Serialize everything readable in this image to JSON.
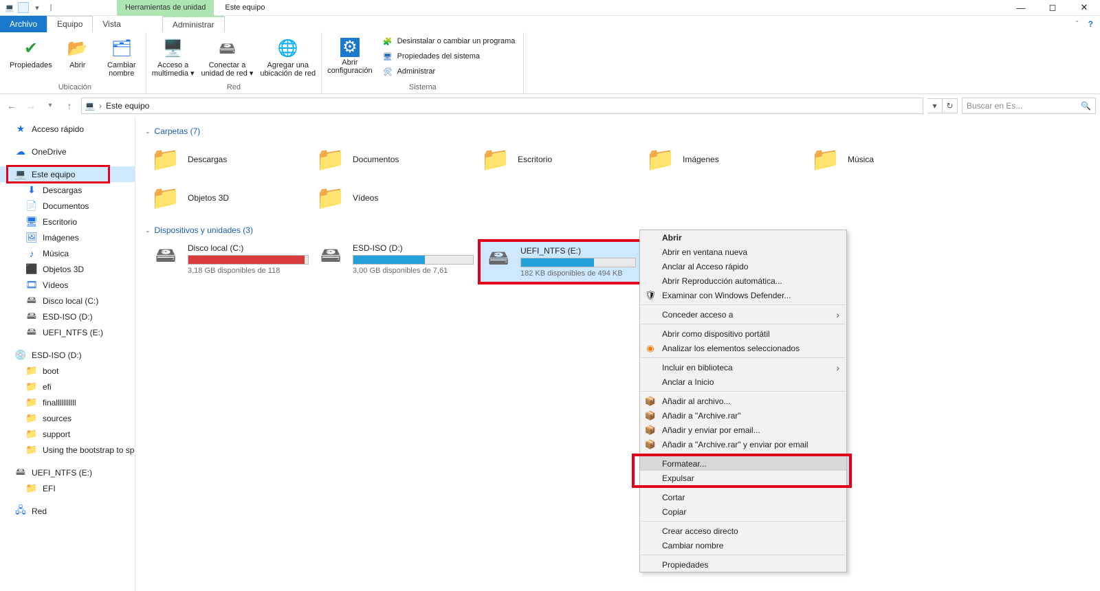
{
  "titlebar": {
    "context_tab": "Herramientas de unidad",
    "window_title": "Este equipo"
  },
  "tabs": {
    "file": "Archivo",
    "equipo": "Equipo",
    "vista": "Vista",
    "administrar": "Administrar"
  },
  "ribbon": {
    "ubicacion": {
      "name": "Ubicación",
      "propiedades": "Propiedades",
      "abrir": "Abrir",
      "cambiar_nombre": "Cambiar\nnombre"
    },
    "red": {
      "name": "Red",
      "acceso": "Acceso a\nmultimedia ▾",
      "conectar": "Conectar a\nunidad de red ▾",
      "agregar": "Agregar una\nubicación de red"
    },
    "sistema": {
      "name": "Sistema",
      "abrir_cfg": "Abrir\nconfiguración",
      "desinstalar": "Desinstalar o cambiar un programa",
      "propiedades_sistema": "Propiedades del sistema",
      "administrar": "Administrar"
    }
  },
  "nav": {
    "location": "Este equipo",
    "search_placeholder": "Buscar en Es..."
  },
  "sidebar": {
    "acceso_rapido": "Acceso rápido",
    "onedrive": "OneDrive",
    "este_equipo": "Este equipo",
    "descargas": "Descargas",
    "documentos": "Documentos",
    "escritorio": "Escritorio",
    "imagenes": "Imágenes",
    "musica": "Música",
    "objetos3d": "Objetos 3D",
    "videos": "Vídeos",
    "disco_c": "Disco local (C:)",
    "esd_iso": "ESD-ISO (D:)",
    "uefi": "UEFI_NTFS (E:)",
    "esd_iso_root": "ESD-ISO (D:)",
    "boot": "boot",
    "efi": "efi",
    "final": "finalllllllllll",
    "sources": "sources",
    "support": "support",
    "bootstrap": "Using the bootstrap to speed",
    "uefi_root": "UEFI_NTFS (E:)",
    "efi2": "EFI",
    "red": "Red"
  },
  "sections": {
    "carpetas": "Carpetas (7)",
    "dispositivos": "Dispositivos y unidades (3)"
  },
  "folders": [
    {
      "label": "Descargas",
      "icon": "download"
    },
    {
      "label": "Documentos",
      "icon": "document"
    },
    {
      "label": "Escritorio",
      "icon": "desktop"
    },
    {
      "label": "Imágenes",
      "icon": "images"
    },
    {
      "label": "Música",
      "icon": "music"
    },
    {
      "label": "Objetos 3D",
      "icon": "3d"
    },
    {
      "label": "Vídeos",
      "icon": "video"
    }
  ],
  "drives": {
    "c": {
      "name": "Disco local (C:)",
      "free": "3,18 GB disponibles de 118",
      "pct": 97,
      "color": "#d83b3b"
    },
    "d": {
      "name": "ESD-ISO (D:)",
      "free": "3,00 GB disponibles de 7,61",
      "pct": 60,
      "color": "#26a0da"
    },
    "e": {
      "name": "UEFI_NTFS (E:)",
      "free": "182 KB disponibles de 494 KB",
      "pct": 64,
      "color": "#26a0da"
    }
  },
  "context_menu": {
    "abrir": "Abrir",
    "ventana_nueva": "Abrir en ventana nueva",
    "anclar_acceso": "Anclar al Acceso rápido",
    "reproduccion": "Abrir Reproducción automática...",
    "defender": "Examinar con Windows Defender...",
    "conceder": "Conceder acceso a",
    "portatil": "Abrir como dispositivo portátil",
    "analizar": "Analizar los elementos seleccionados",
    "biblioteca": "Incluir en biblioteca",
    "anclar_inicio": "Anclar a Inicio",
    "anadir_archivo": "Añadir al archivo...",
    "anadir_archive": "Añadir a \"Archive.rar\"",
    "anadir_email": "Añadir y enviar por email...",
    "anadir_archive_email": "Añadir a \"Archive.rar\" y enviar por email",
    "formatear": "Formatear...",
    "expulsar": "Expulsar",
    "cortar": "Cortar",
    "copiar": "Copiar",
    "crear_acceso": "Crear acceso directo",
    "cambiar_nombre": "Cambiar nombre",
    "propiedades": "Propiedades"
  }
}
